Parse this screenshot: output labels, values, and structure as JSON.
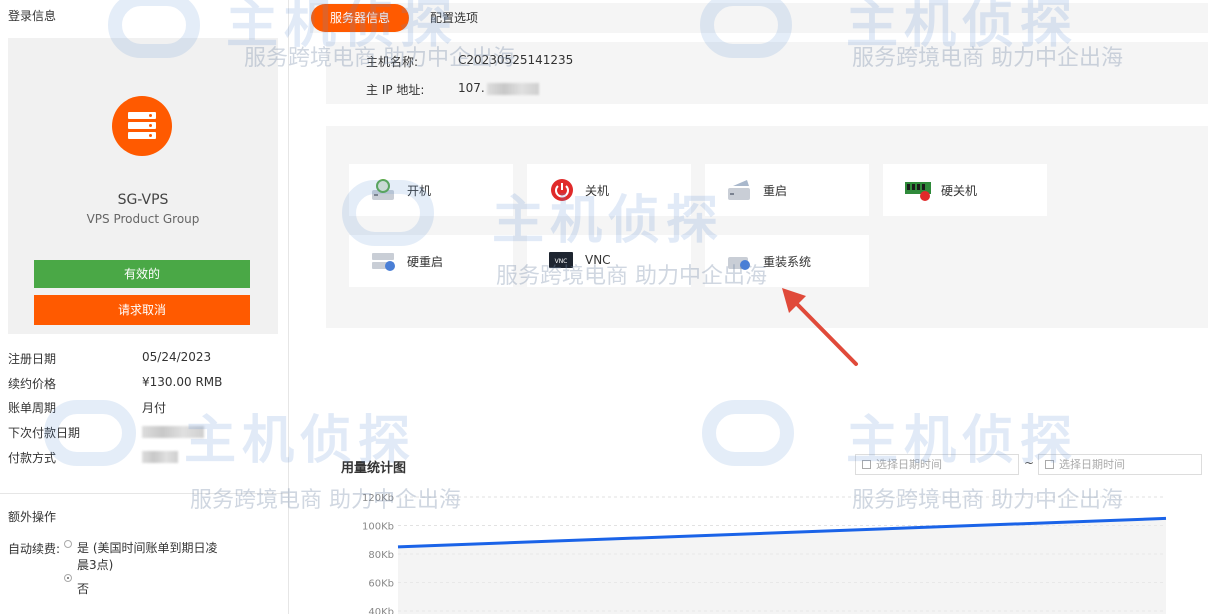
{
  "sidebar": {
    "login_title": "登录信息",
    "product": {
      "name": "SG-VPS",
      "group": "VPS Product Group"
    },
    "status_button": "有效的",
    "cancel_button": "请求取消",
    "info": [
      {
        "label": "注册日期",
        "value": "05/24/2023"
      },
      {
        "label": "续约价格",
        "value": "¥130.00 RMB"
      },
      {
        "label": "账单周期",
        "value": "月付"
      },
      {
        "label": "下次付款日期",
        "value": ""
      },
      {
        "label": "付款方式",
        "value": ""
      }
    ],
    "extra_title": "额外操作",
    "auto_renew": {
      "label": "自动续费:",
      "options": [
        "是 (美国时间账单到期日凌晨3点)",
        "否"
      ],
      "selected": "否"
    }
  },
  "tabs": {
    "active": "服务器信息",
    "other": "配置选项"
  },
  "server_info": {
    "hostname_label": "主机名称:",
    "hostname": "C20230525141235",
    "ip_label": "主 IP 地址:",
    "ip": "107."
  },
  "operations": [
    {
      "label": "开机",
      "icon": "power-on-drive-icon"
    },
    {
      "label": "关机",
      "icon": "power-off-icon"
    },
    {
      "label": "重启",
      "icon": "restart-drive-icon"
    },
    {
      "label": "硬关机",
      "icon": "hard-shutdown-ram-icon"
    },
    {
      "label": "硬重启",
      "icon": "hard-reboot-icon"
    },
    {
      "label": "VNC",
      "icon": "vnc-icon"
    },
    {
      "label": "重装系统",
      "icon": "reinstall-os-icon"
    }
  ],
  "usage": {
    "title": "用量统计图",
    "date_placeholder": "选择日期时间",
    "date_separator": "~"
  },
  "chart_data": {
    "type": "line",
    "y_ticks": [
      "120Kb",
      "100Kb",
      "80Kb",
      "60Kb",
      "40Kb"
    ],
    "series": [
      {
        "values": [
          85,
          105
        ]
      }
    ],
    "ylim": [
      40,
      120
    ],
    "grid": true,
    "line_color": "#1a63e8"
  },
  "watermark": {
    "brand": "主机侦探",
    "slogan": "服务跨境电商 助力中企出海"
  },
  "colors": {
    "accent": "#ff5a00",
    "success": "#4aa846",
    "panel": "#f5f5f5"
  }
}
